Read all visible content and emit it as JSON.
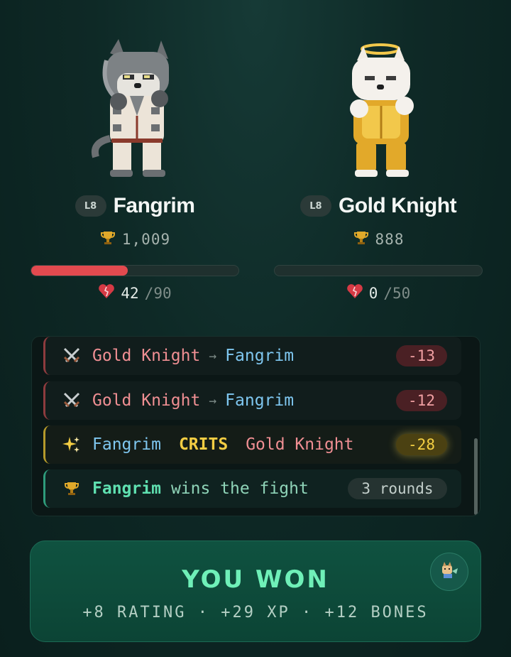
{
  "fighters": [
    {
      "level": "L8",
      "name": "Fangrim",
      "rating": "1,009",
      "hp_current": "42",
      "hp_max": "/90",
      "hp_fraction": 0.467,
      "sprite": "wolf-fighter"
    },
    {
      "level": "L8",
      "name": "Gold Knight",
      "rating": "888",
      "hp_current": "0",
      "hp_max": "/50",
      "hp_fraction": 0,
      "sprite": "white-wolf-gold-armor-halo"
    }
  ],
  "log": [
    {
      "type": "hit",
      "icon": "crossed-swords-icon",
      "attacker": "Gold Knight",
      "arrow": "→",
      "target": "Fangrim",
      "value": "-13"
    },
    {
      "type": "hit",
      "icon": "crossed-swords-icon",
      "attacker": "Gold Knight",
      "arrow": "→",
      "target": "Fangrim",
      "value": "-12"
    },
    {
      "type": "crit",
      "icon": "sparkles-icon",
      "attacker": "Fangrim",
      "verb": "CRITS",
      "target": "Gold Knight",
      "value": "-28"
    },
    {
      "type": "win",
      "icon": "trophy-icon",
      "winner": "Fangrim",
      "text": "wins the fight",
      "value": "3 rounds"
    }
  ],
  "result": {
    "title": "YOU WON",
    "rewards": "+8 RATING · +29 XP · +12 BONES",
    "share_icon": "dog-share-icon"
  },
  "colors": {
    "accent": "#6ff0b8",
    "hp": "#e24a4f",
    "crit": "#f3cd43"
  }
}
